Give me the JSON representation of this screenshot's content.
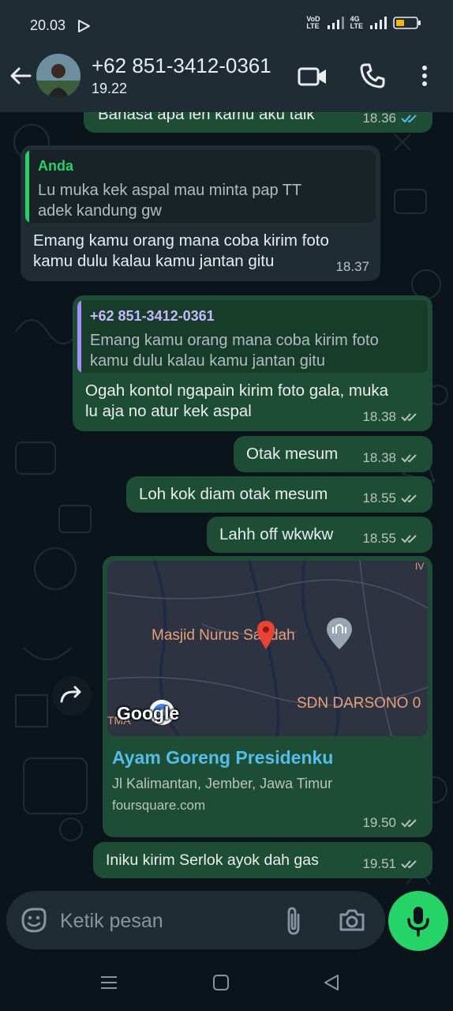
{
  "status_bar": {
    "time": "20.03",
    "vo_top": "VoD",
    "vo_bottom": "LTE",
    "net_top": "4G",
    "net_bottom": "LTE"
  },
  "header": {
    "contact_name": "+62 851-3412-0361",
    "contact_status": "19.22"
  },
  "messages": [
    {
      "type": "outgoing",
      "text": "Bahasa apa len kamu aku taik",
      "time": "18.36",
      "ticks": "blue"
    },
    {
      "type": "incoming",
      "quote": {
        "name": "Anda",
        "text": [
          "Lu muka kek aspal mau minta pap TT",
          "adek kandung gw"
        ]
      },
      "text": [
        "Emang kamu orang mana coba kirim foto",
        "kamu dulu kalau kamu jantan gitu"
      ],
      "time": "18.37"
    },
    {
      "type": "outgoing",
      "quote": {
        "name": "+62 851-3412-0361",
        "text": [
          "Emang kamu orang mana coba kirim foto",
          "kamu dulu kalau kamu jantan gitu"
        ]
      },
      "text": [
        "Ogah kontol ngapain kirim foto gala, muka",
        "lu aja no atur kek aspal"
      ],
      "time": "18.38",
      "ticks": "grey"
    },
    {
      "type": "outgoing",
      "text": "Otak mesum",
      "time": "18.38",
      "ticks": "grey"
    },
    {
      "type": "outgoing",
      "text": "Loh kok diam otak mesum",
      "time": "18.55",
      "ticks": "grey"
    },
    {
      "type": "outgoing",
      "text": "Lahh off wkwkw",
      "time": "18.55",
      "ticks": "grey"
    },
    {
      "type": "location",
      "map_labels": {
        "mosque": "Masjid Nurus Saadah",
        "school": "SDN DARSONO 0",
        "corner": "IV",
        "left": "TMA",
        "logo": "Google"
      },
      "place_name": "Ayam Goreng Presidenku",
      "address": "Jl Kalimantan, Jember, Jawa Timur",
      "source": "foursquare.com",
      "time": "19.50",
      "ticks": "grey"
    },
    {
      "type": "outgoing",
      "text": "Iniku kirim Serlok ayok dah gas",
      "time": "19.51",
      "ticks": "grey"
    }
  ],
  "composer": {
    "placeholder": "Ketik pesan"
  },
  "icons": [
    "arrow-back-icon",
    "video-call-icon",
    "phone-icon",
    "more-vert-icon",
    "forward-icon",
    "emoji-icon",
    "attach-icon",
    "camera-icon",
    "mic-icon",
    "double-check-icon",
    "map-pin-icon",
    "mosque-marker-icon"
  ],
  "colors": {
    "outgoing_bubble": "#1e4d36",
    "incoming_bubble": "#202c33",
    "accent": "#25d366",
    "read_ticks": "#53bdeb",
    "place_name": "#53bdeb"
  }
}
